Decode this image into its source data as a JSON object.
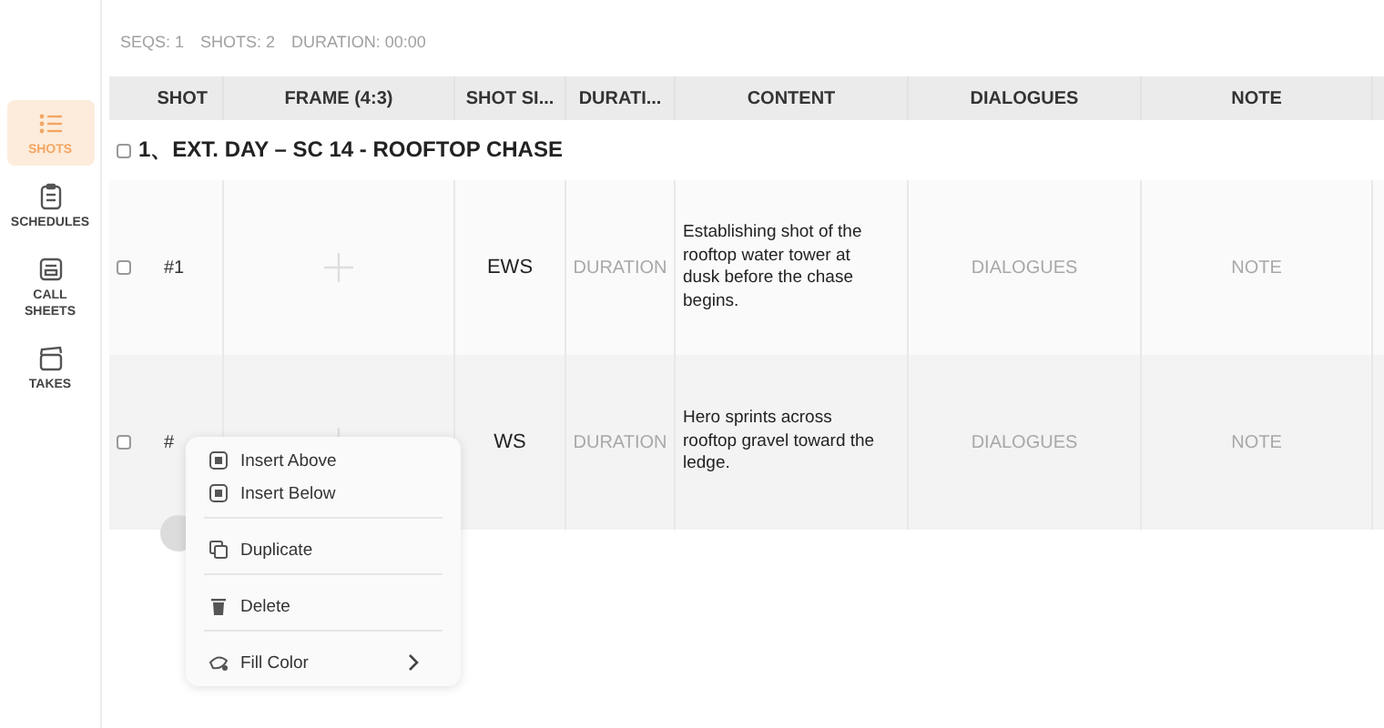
{
  "sidebar": {
    "items": [
      {
        "label": "SHOTS",
        "kind": "list",
        "selected": true
      },
      {
        "label": "SCHEDULES",
        "kind": "clipboard",
        "selected": false
      },
      {
        "label": "CALL SHEETS",
        "kind": "sheet",
        "selected": false
      },
      {
        "label": "TAKES",
        "kind": "clapper",
        "selected": false
      }
    ]
  },
  "stats": [
    "SEQS: 1",
    "SHOTS: 2",
    "DURATION: 00:00"
  ],
  "table": {
    "columns": [
      "SHOT",
      "FRAME (4:3)",
      "SHOT SI...",
      "DURATI...",
      "CONTENT",
      "DIALOGUES",
      "NOTE"
    ],
    "group": {
      "title": "1、EXT. DAY – SC 14 - ROOFTOP CHASE",
      "checked": false
    },
    "rows": [
      {
        "checked": false,
        "shot": "#1",
        "shot_size": "EWS",
        "duration_placeholder": "DURATION",
        "content": "Establishing shot of the rooftop water tower at dusk before the chase begins.",
        "dialogues_placeholder": "DIALOGUES",
        "note_placeholder": "NOTE"
      },
      {
        "checked": false,
        "shot": "#",
        "shot_size": "WS",
        "duration_placeholder": "DURATION",
        "content": "Hero sprints across rooftop gravel toward the ledge.",
        "dialogues_placeholder": "DIALOGUES",
        "note_placeholder": "NOTE"
      }
    ]
  },
  "context_menu": {
    "items": [
      {
        "label": "Insert Above",
        "kind": "insert",
        "divider_before": false,
        "submenu": false
      },
      {
        "label": "Insert Below",
        "kind": "insert",
        "divider_before": false,
        "submenu": false
      },
      {
        "label": "Duplicate",
        "kind": "duplicate",
        "divider_before": true,
        "submenu": false
      },
      {
        "label": "Delete",
        "kind": "trash",
        "divider_before": true,
        "submenu": false
      },
      {
        "label": "Fill Color",
        "kind": "fill",
        "divider_before": true,
        "submenu": true
      }
    ]
  }
}
